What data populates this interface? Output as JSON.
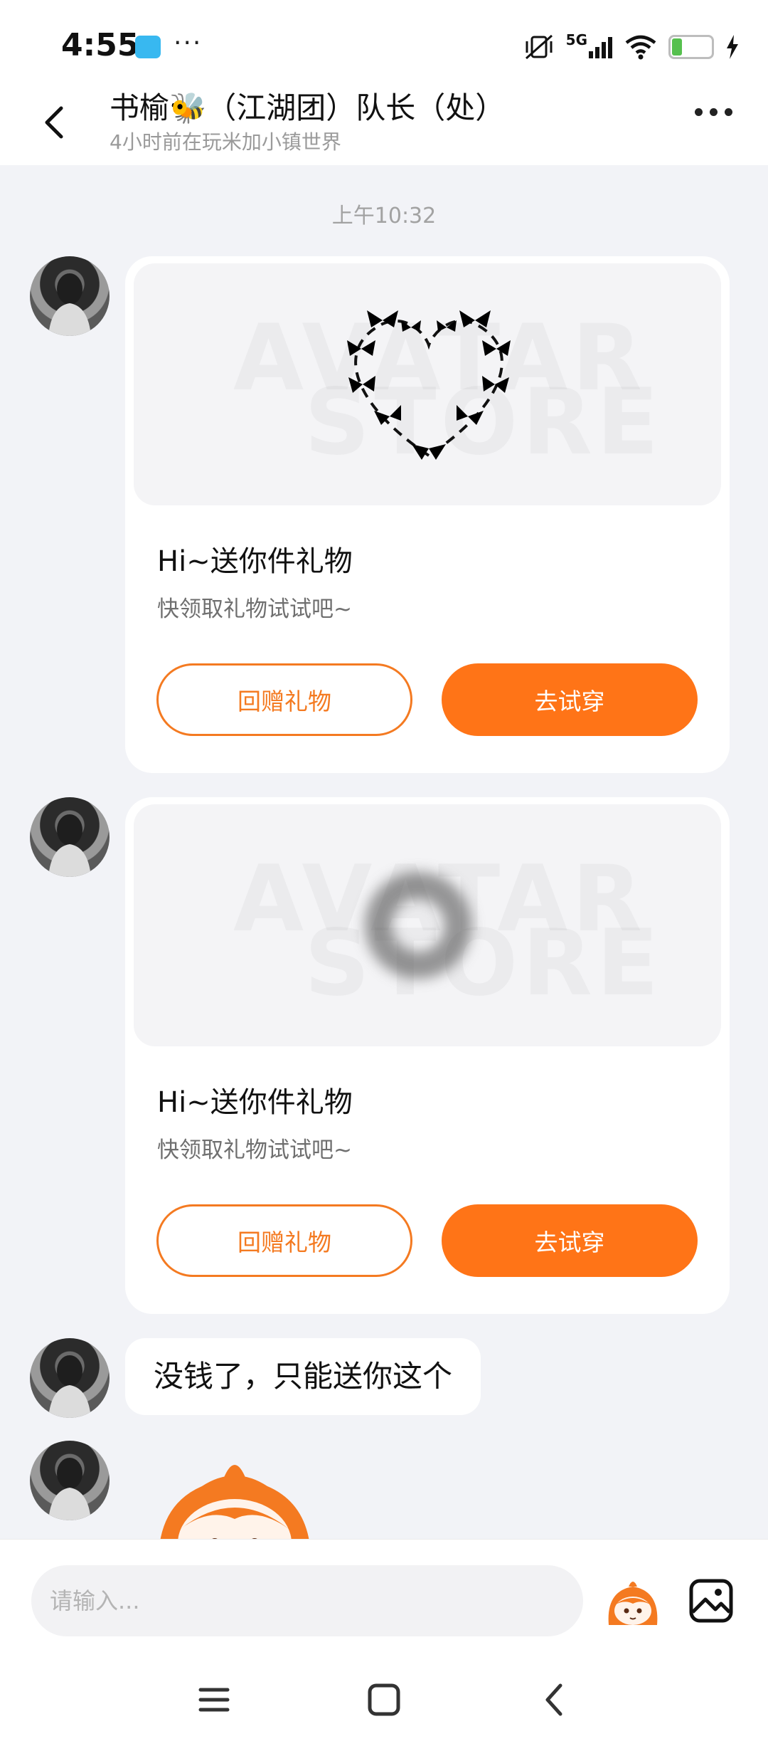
{
  "status_bar": {
    "time": "4:55",
    "network": "5G",
    "battery": "11",
    "icons": [
      "clapper-icon",
      "more-icon",
      "mute-vibrate-icon",
      "signal-icon",
      "wifi-icon",
      "battery-icon",
      "charging-icon"
    ]
  },
  "header": {
    "title": "书榆🐝（江湖团）队长（处）",
    "subtitle": "4小时前在玩米加小镇世界"
  },
  "chat": {
    "timestamp": "上午10:32",
    "messages": [
      {
        "type": "gift",
        "title": "Hi~送你件礼物",
        "subtitle": "快领取礼物试试吧~",
        "return_gift_label": "回赠礼物",
        "try_on_label": "去试穿",
        "preview": "butterfly-heart"
      },
      {
        "type": "gift",
        "title": "Hi~送你件礼物",
        "subtitle": "快领取礼物试试吧~",
        "return_gift_label": "回赠礼物",
        "try_on_label": "去试穿",
        "preview": "dark-ring"
      },
      {
        "type": "text",
        "text": "没钱了，只能送你这个"
      },
      {
        "type": "sticker",
        "sticker": "orange-mascot"
      }
    ]
  },
  "watermark": {
    "line1": "AVATAR",
    "line2": "STORE"
  },
  "input": {
    "placeholder": "请输入..."
  },
  "colors": {
    "accent": "#ff7417",
    "background": "#f2f3f7",
    "card": "#ffffff"
  }
}
